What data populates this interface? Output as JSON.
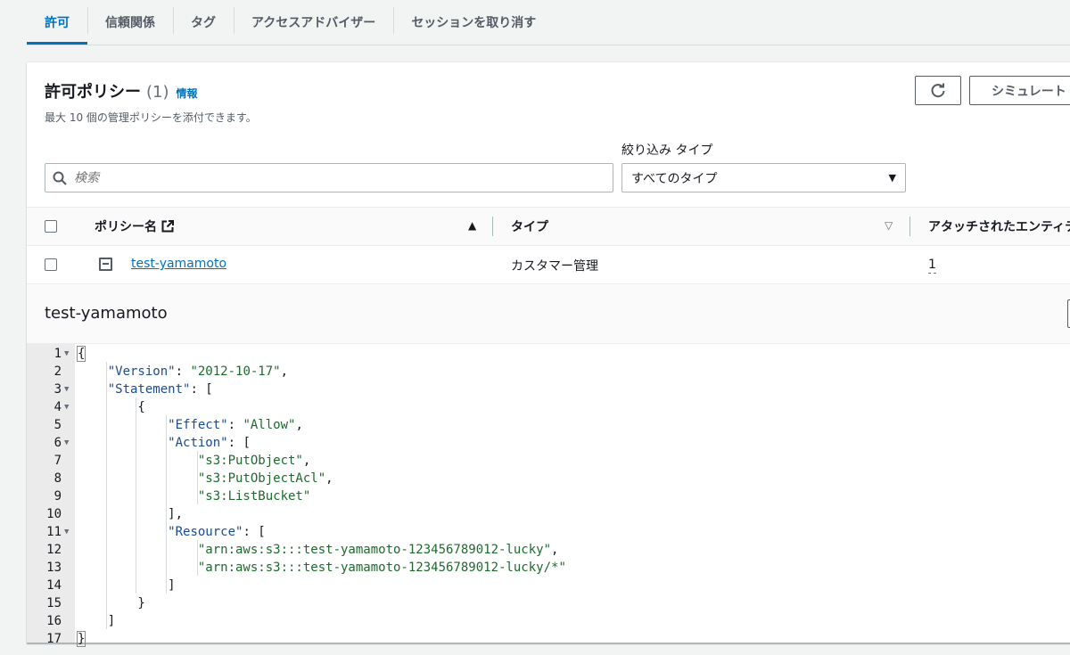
{
  "tabs": [
    "許可",
    "信頼関係",
    "タグ",
    "アクセスアドバイザー",
    "セッションを取り消す"
  ],
  "panel": {
    "title": "許可ポリシー",
    "count": "(1)",
    "info_link": "情報",
    "description": "最大 10 個の管理ポリシーを添付できます。",
    "simulate_button": "シミュレート",
    "filter_label": "絞り込み タイプ",
    "search_placeholder": "検索",
    "filter_value": "すべてのタイプ"
  },
  "table": {
    "columns": [
      "ポリシー名",
      "タイプ",
      "アタッチされたエンティティ"
    ],
    "rows": [
      {
        "name": "test-yamamoto",
        "type": "カスタマー管理",
        "attached": "1"
      }
    ]
  },
  "detail": {
    "title": "test-yamamoto",
    "lines": [
      "{",
      "    \"Version\": \"2012-10-17\",",
      "    \"Statement\": [",
      "        {",
      "            \"Effect\": \"Allow\",",
      "            \"Action\": [",
      "                \"s3:PutObject\",",
      "                \"s3:PutObjectAcl\",",
      "                \"s3:ListBucket\"",
      "            ],",
      "            \"Resource\": [",
      "                \"arn:aws:s3:::test-yamamoto-123456789012-lucky\",",
      "                \"arn:aws:s3:::test-yamamoto-123456789012-lucky/*\"",
      "            ]",
      "        }",
      "    ]",
      "}"
    ],
    "foldable_lines": [
      1,
      3,
      4,
      6,
      11
    ]
  },
  "icons": {
    "search": "search-icon",
    "refresh": "refresh-icon",
    "external": "external-link-icon",
    "sort_asc": "sort-ascending-icon",
    "sort_desc": "sort-descending-icon",
    "collapse": "collapse-icon",
    "dropdown": "caret-down-icon"
  },
  "colors": {
    "accent": "#0073bb",
    "json_key": "#1a4b8f",
    "json_string": "#1d6a2c"
  }
}
